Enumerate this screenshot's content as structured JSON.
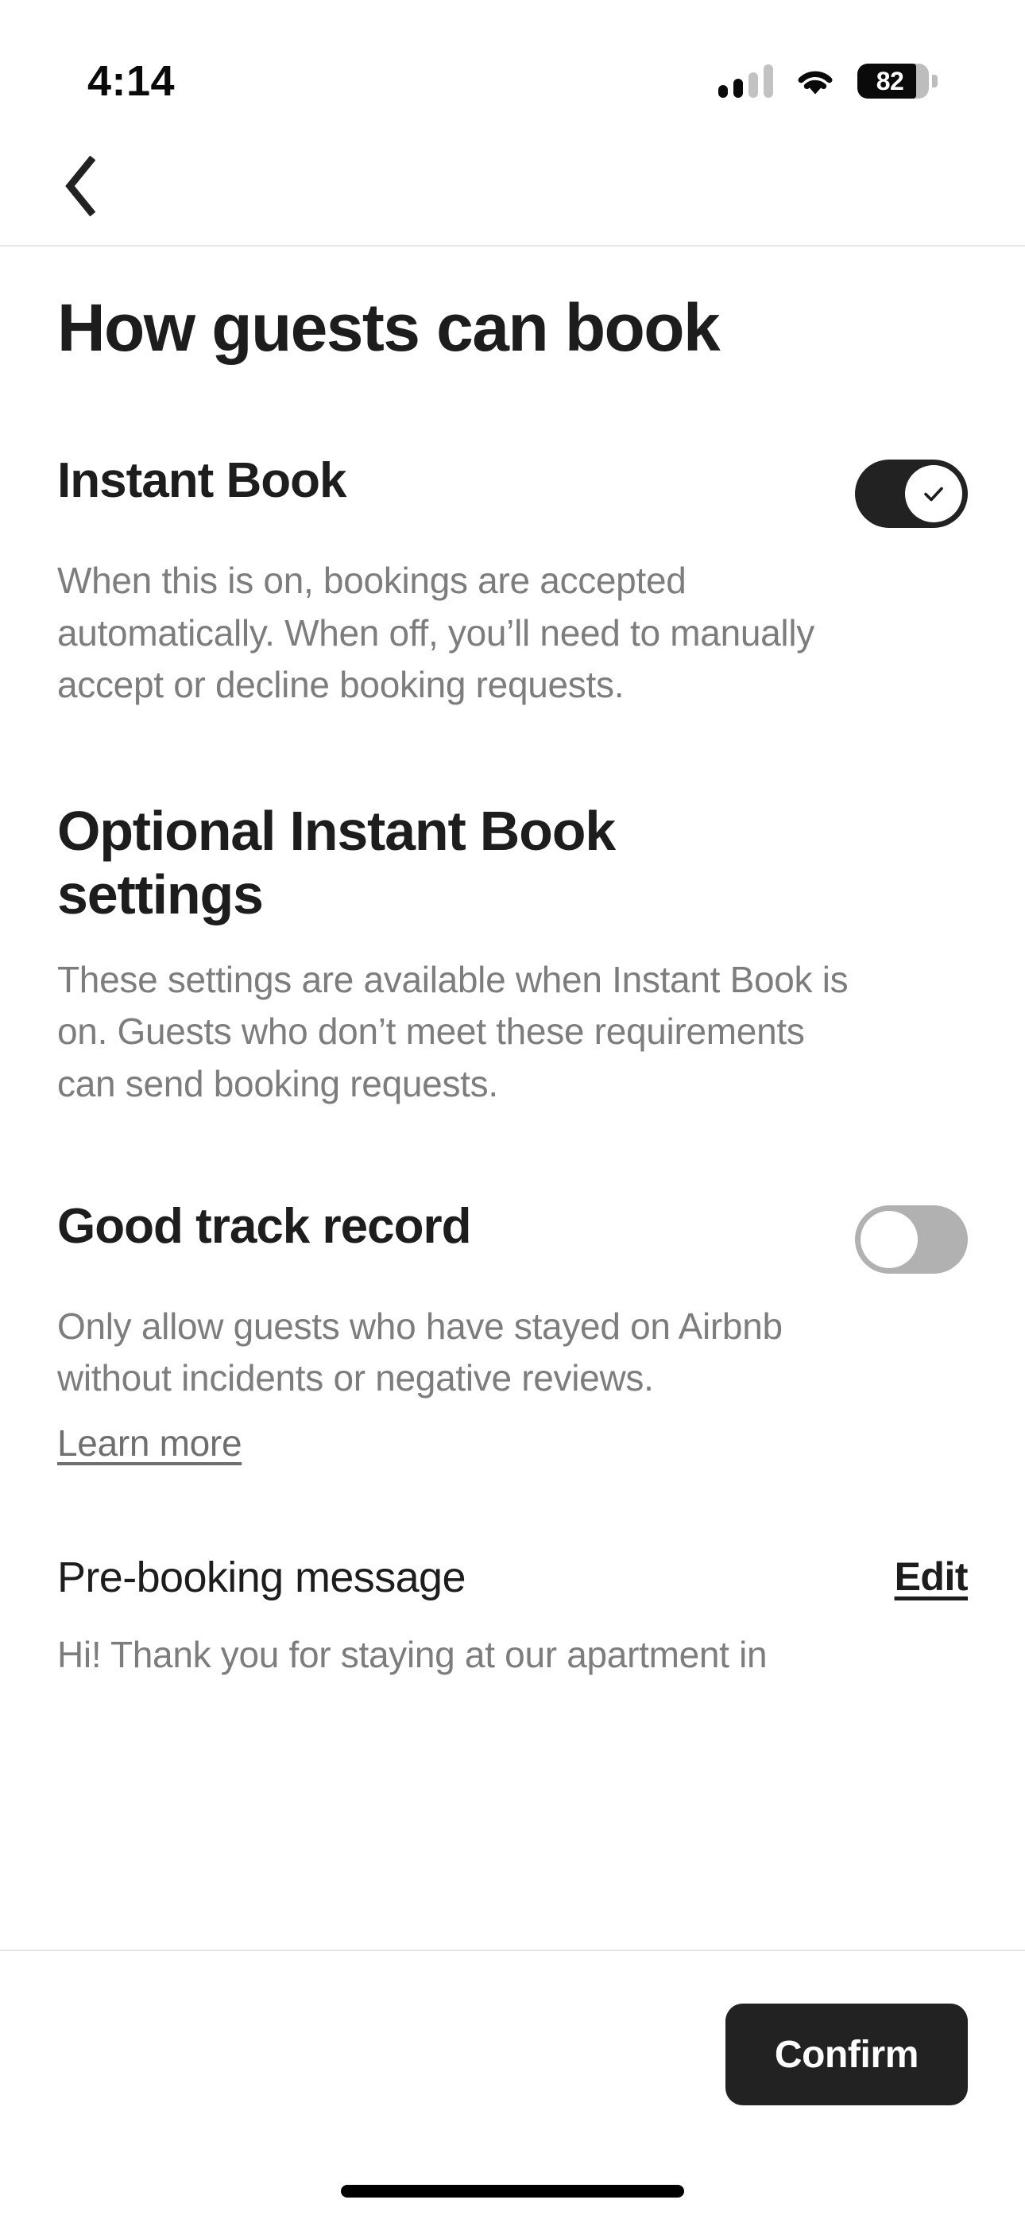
{
  "status_bar": {
    "time": "4:14",
    "battery_percent": "82",
    "signal_bars_total": 4,
    "signal_bars_active": 2,
    "icons": {
      "cellular": "cellular-signal-icon",
      "wifi": "wifi-icon",
      "battery": "battery-icon"
    }
  },
  "nav": {
    "back_icon": "chevron-left-icon"
  },
  "page": {
    "title": "How guests can book"
  },
  "instant_book": {
    "title": "Instant Book",
    "description": "When this is on, bookings are accepted automatically. When off, you’ll need to manually accept or decline booking requests.",
    "toggle_state": "on",
    "toggle_icon": "check-icon"
  },
  "optional_settings": {
    "heading": "Optional Instant Book settings",
    "description": "These settings are available when Instant Book is on. Guests who don’t meet these requirements can send booking requests."
  },
  "good_track_record": {
    "title": "Good track record",
    "description": "Only allow guests who have stayed on Airbnb without incidents or negative reviews.",
    "learn_more_label": "Learn more",
    "toggle_state": "off"
  },
  "pre_booking_message": {
    "title": "Pre-booking message",
    "edit_label": "Edit",
    "message_preview": "Hi! Thank you for staying at our apartment in"
  },
  "footer": {
    "confirm_label": "Confirm"
  },
  "colors": {
    "text_primary": "#1d1d1d",
    "text_secondary": "#7d7d7d",
    "toggle_on": "#222222",
    "toggle_off": "#b1b1b1",
    "button_bg": "#222222",
    "divider": "#e6e6e6"
  }
}
